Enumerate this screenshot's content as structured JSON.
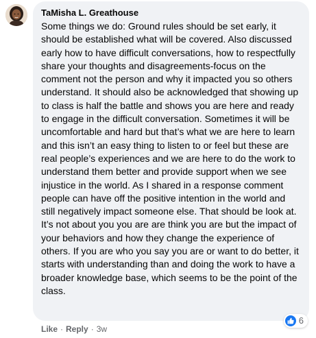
{
  "comment": {
    "author": "TaMisha L. Greathouse",
    "text": "Some things we do: Ground rules should be set early, it should be established what will be covered. Also discussed early how to have difficult conversations, how to respectfully share your thoughts and disagreements-focus on the comment not the person and why it impacted you so others understand. It should also be acknowledged that showing up to class is half the battle and shows you are here and ready to engage in the difficult conversation. Sometimes it will be uncomfortable and hard but that’s what we are here to learn and this isn’t an easy thing to listen to or feel but these are real people’s experiences and we are here to do the work to understand them better and provide support when we see injustice in the world. As I shared in a response comment people can have off the positive intention in the world and still negatively impact someone else. That should be look at. It’s not about you you are are think you are but the impact of your behaviors and how they change the experience of others. If you are who you say you are or want to do better, it starts with understanding than and doing the work to have a broader knowledge base, which seems to be the point of the class.",
    "reactions": {
      "icon": "like-icon",
      "count": "6",
      "color": "#1877f2"
    }
  },
  "actions": {
    "like_label": "Like",
    "separator": "·",
    "reply_label": "Reply",
    "timestamp": "3w"
  },
  "colors": {
    "bubble_bg": "#f0f2f5",
    "secondary_text": "#65676b",
    "primary_text": "#050505"
  }
}
